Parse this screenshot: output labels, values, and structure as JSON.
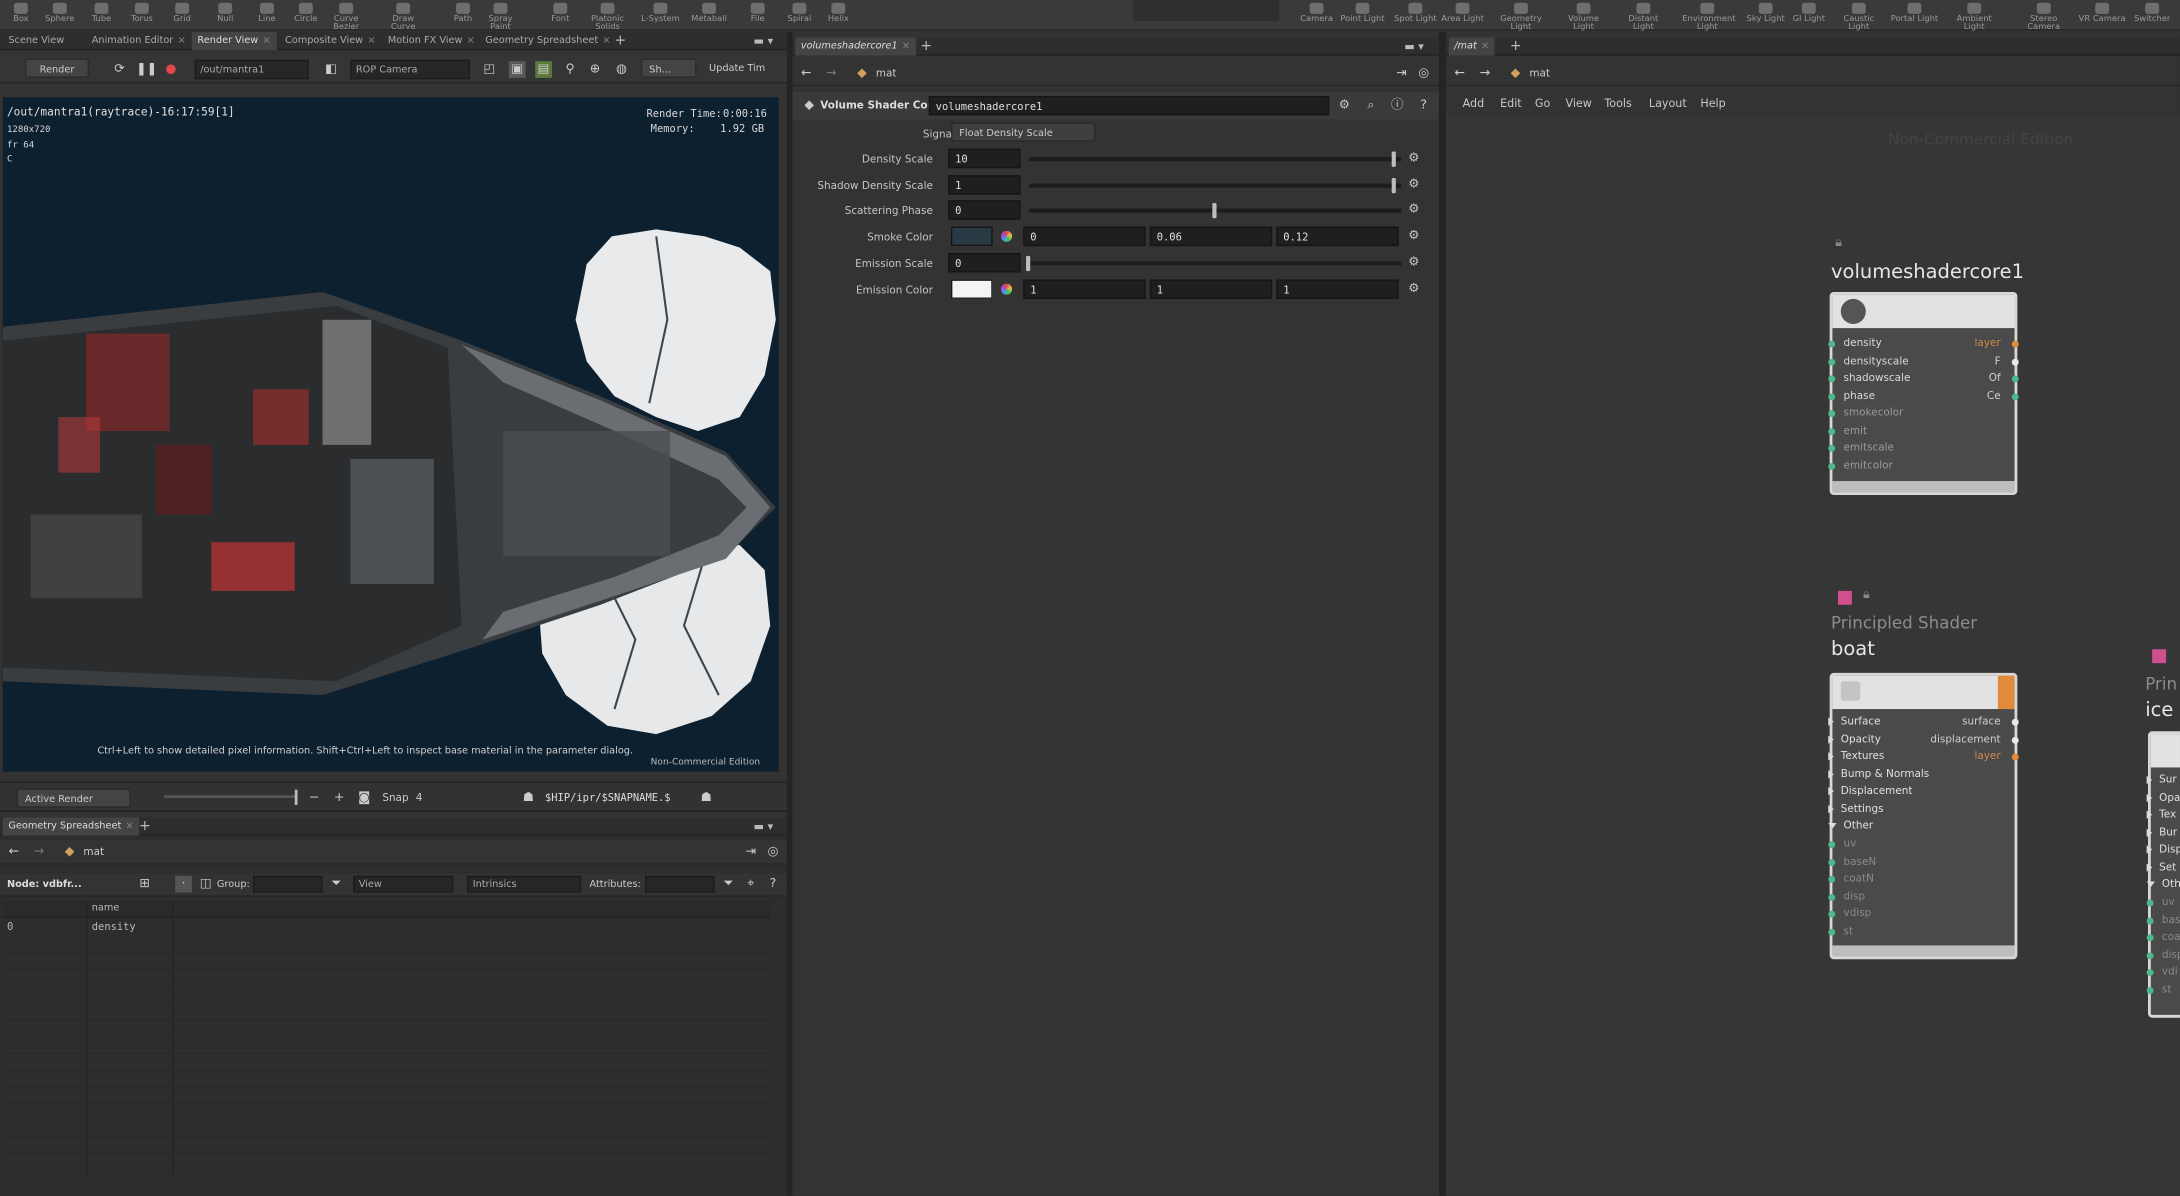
{
  "shelf": {
    "tools": [
      "Box",
      "Sphere",
      "Tube",
      "Torus",
      "Grid",
      "Null",
      "Line",
      "Circle",
      "Curve Bezier",
      "Draw Curve",
      "Path",
      "Spray Paint",
      "Font",
      "Platonic Solids",
      "L-System",
      "Metaball",
      "File",
      "Spiral",
      "Helix"
    ],
    "lights": [
      "Camera",
      "Point Light",
      "Spot Light",
      "Area Light",
      "Geometry Light",
      "Volume Light",
      "Distant Light",
      "Environment Light",
      "Sky Light",
      "GI Light",
      "Caustic Light",
      "Portal Light",
      "Ambient Light",
      "Stereo Camera",
      "VR Camera",
      "Switcher"
    ]
  },
  "left_tabs": [
    "Scene View",
    "Animation Editor",
    "Render View",
    "Composite View",
    "Motion FX View",
    "Geometry Spreadsheet"
  ],
  "render_toolbar": {
    "render_label": "Render",
    "rop_path": "/out/mantra1",
    "camera": "ROP Camera",
    "sh_label": "Sh...",
    "update_label": "Update Tim"
  },
  "viewport": {
    "path": "/out/mantra1(raytrace)-16:17:59[1]",
    "resolution": "1280x720",
    "frame": "fr 64",
    "channel": "C",
    "render_time_label": "Render Time:",
    "render_time": "0:00:16",
    "memory_label": "Memory:",
    "memory": "1.92 GB",
    "hint": "Ctrl+Left to show detailed pixel information. Shift+Ctrl+Left to inspect base material in the parameter dialog.",
    "watermark": "Non-Commercial Edition"
  },
  "render_bar": {
    "active_render": "Active Render",
    "snap_label": "Snap",
    "snap_value": "4",
    "snapshot_path": "$HIP/ipr/$SNAPNAME.$"
  },
  "spreadsheet": {
    "tab": "Geometry Spreadsheet",
    "path": "mat",
    "node_label": "Node: vdbfr...",
    "group_label": "Group:",
    "view_label": "View",
    "intrinsics_label": "Intrinsics",
    "attributes_label": "Attributes:",
    "col_header": "name",
    "rows": [
      {
        "index": "0",
        "name": "density"
      }
    ]
  },
  "params": {
    "tab": "volumeshadercore1",
    "path": "mat",
    "node_type": "Volume Shader Core",
    "node_name": "volumeshadercore1",
    "signature_label": "Signature",
    "signature_value": "Float Density Scale",
    "rows": [
      {
        "label": "Density Scale",
        "value": "10",
        "slider": 0.98
      },
      {
        "label": "Shadow Density Scale",
        "value": "1",
        "slider": 0.98
      },
      {
        "label": "Scattering Phase",
        "value": "0",
        "slider": 0.5
      },
      {
        "label": "Smoke Color",
        "r": "0",
        "g": "0.06",
        "b": "0.12",
        "swatch": "#2a3a44"
      },
      {
        "label": "Emission Scale",
        "value": "0",
        "slider": 0.0
      },
      {
        "label": "Emission Color",
        "r": "1",
        "g": "1",
        "b": "1",
        "swatch": "#f4f4f4"
      }
    ]
  },
  "network": {
    "tab": "/mat",
    "path": "mat",
    "menus": [
      "Add",
      "Edit",
      "Go",
      "View",
      "Tools",
      "Layout",
      "Help"
    ],
    "watermark": "Non-Commercial Edition",
    "vsc": {
      "name": "volumeshadercore1",
      "inputs": [
        "density",
        "densityscale",
        "shadowscale",
        "phase",
        "smokecolor",
        "emit",
        "emitscale",
        "emitcolor"
      ],
      "outputs": [
        "layer",
        "F",
        "Of",
        "Ce"
      ]
    },
    "principled": {
      "type": "Principled Shader",
      "name": "boat",
      "groups": [
        "Surface",
        "Opacity",
        "Textures",
        "Bump & Normals",
        "Displacement",
        "Settings",
        "Other"
      ],
      "outputs": [
        "surface",
        "displacement",
        "layer"
      ],
      "other_inputs": [
        "uv",
        "baseN",
        "coatN",
        "disp",
        "vdisp",
        "st"
      ]
    },
    "principled2": {
      "type": "Prin",
      "name": "ice",
      "groups": [
        "Sur",
        "Opa",
        "Tex",
        "Bur",
        "Disp",
        "Set",
        "Oth"
      ],
      "inputs": [
        "uv",
        "bas",
        "coa",
        "disp",
        "vdi",
        "st"
      ]
    },
    "colors": {
      "accent_pink": "#d0508f",
      "port_green": "#4fb88a",
      "port_orange": "#e08a3a",
      "port_white": "#e8e8e8"
    }
  }
}
